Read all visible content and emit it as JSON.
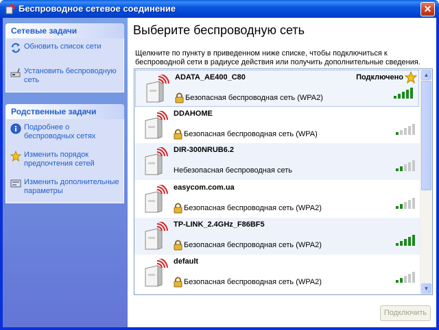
{
  "window": {
    "title": "Беспроводное сетевое соединение",
    "close_label": "✕"
  },
  "taskpane": {
    "network_tasks": {
      "header": "Сетевые задачи",
      "items": [
        {
          "label": "Обновить список сети",
          "icon": "refresh-icon"
        },
        {
          "label": "Установить беспроводную сеть",
          "icon": "setup-network-icon"
        }
      ]
    },
    "related_tasks": {
      "header": "Родственные задачи",
      "items": [
        {
          "label": "Подробнее о беспроводных сетях",
          "icon": "info-icon"
        },
        {
          "label": "Изменить порядок предпочтения  сетей",
          "icon": "star-icon"
        },
        {
          "label": "Изменить дополнительные параметры",
          "icon": "settings-icon"
        }
      ]
    }
  },
  "main": {
    "title": "Выберите беспроводную сеть",
    "instruction": "Щелкните по пункту в приведенном ниже списке, чтобы подключиться к беспроводной сети в радиусе действия или получить дополнительные сведения.",
    "networks": [
      {
        "ssid": "ADATA_AE400_C80",
        "security": "Безопасная беспроводная сеть (WPA2)",
        "secured": true,
        "status": "Подключено",
        "signal_bars": 5,
        "selected": true
      },
      {
        "ssid": "DDAHOME",
        "security": "Безопасная беспроводная сеть (WPA)",
        "secured": true,
        "status": "",
        "signal_bars": 1
      },
      {
        "ssid": "DIR-300NRUB6.2",
        "security": "Небезопасная беспроводная сеть",
        "secured": false,
        "status": "",
        "signal_bars": 2
      },
      {
        "ssid": "easycom.com.ua",
        "security": "Безопасная беспроводная сеть (WPA2)",
        "secured": true,
        "status": "",
        "signal_bars": 2
      },
      {
        "ssid": "TP-LINK_2.4GHz_F86BF5",
        "security": "Безопасная беспроводная сеть (WPA2)",
        "secured": true,
        "status": "",
        "signal_bars": 5
      },
      {
        "ssid": "default",
        "security": "Безопасная беспроводная сеть (WPA2)",
        "secured": true,
        "status": "",
        "signal_bars": 2
      }
    ],
    "connect_button": "Подключить"
  },
  "colors": {
    "titlebar": "#0a56e0",
    "taskpane": "#6375d6",
    "link": "#215dc6",
    "signal_on": "#1b8a1b",
    "signal_off": "#c8c8c8"
  }
}
